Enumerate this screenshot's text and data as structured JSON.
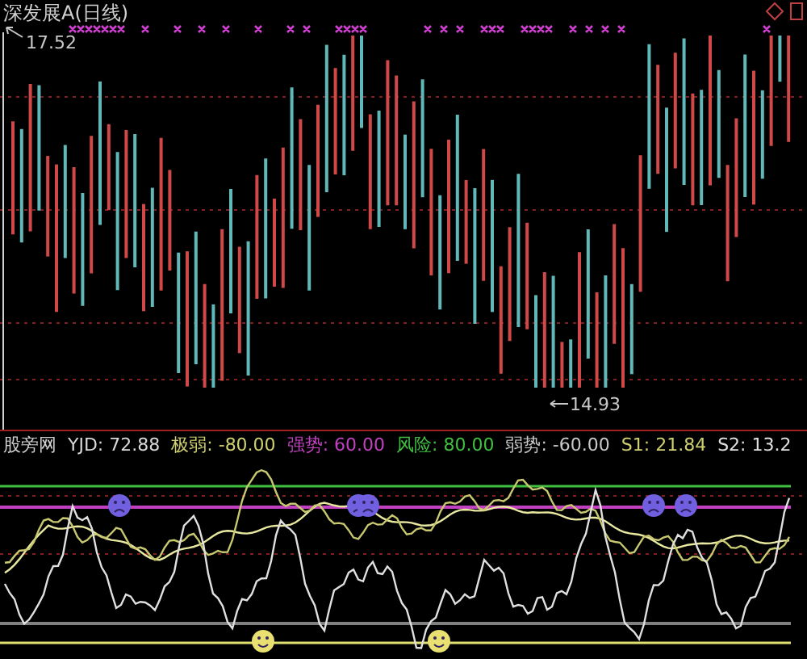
{
  "chart": {
    "title": "深发展A(日线)",
    "high_label": "17.52",
    "low_label": "14.93"
  },
  "indicator": {
    "name": "股旁网",
    "items": [
      {
        "text": "YJD: 72.88",
        "color": "#d8d8d8"
      },
      {
        "text": "极弱: -80.00",
        "color": "#d0d070"
      },
      {
        "text": "强势: 60.00",
        "color": "#c040c0"
      },
      {
        "text": "风险: 80.00",
        "color": "#40c040"
      },
      {
        "text": "弱势: -60.00",
        "color": "#c8c8c8"
      },
      {
        "text": "S1: 21.84",
        "color": "#d0d070"
      },
      {
        "text": "S2: 13.2",
        "color": "#e0e0e0"
      }
    ]
  }
}
